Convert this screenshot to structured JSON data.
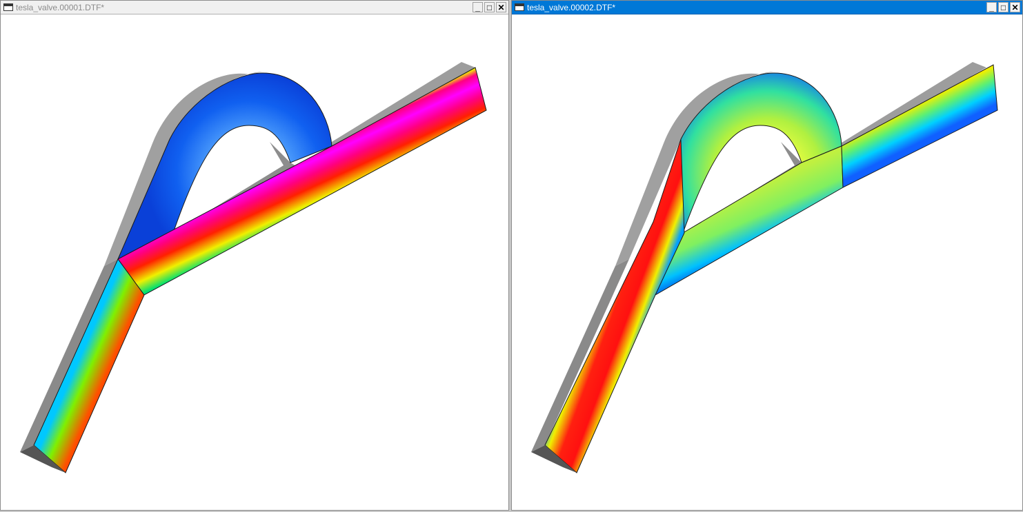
{
  "windows": [
    {
      "title": "tesla_valve.00001.DTF*",
      "active": false,
      "flow_state": "forward",
      "palette": {
        "low": "#1f6ff0",
        "mid": "#00e06a",
        "high": "#ff0a7a",
        "peak": "#ff00ff"
      }
    },
    {
      "title": "tesla_valve.00002.DTF*",
      "active": true,
      "flow_state": "reverse",
      "palette": {
        "low": "#1040f0",
        "mid": "#aef000",
        "high": "#ff1010",
        "peak": "#ffd000"
      }
    }
  ],
  "controls": {
    "minimize": "_",
    "maximize": "□",
    "close": "✕"
  },
  "colors": {
    "side_face": "#9a9a9a",
    "outline": "#1a1a1a",
    "active_title": "#0078d7",
    "inactive_title": "#f0f0f0"
  }
}
